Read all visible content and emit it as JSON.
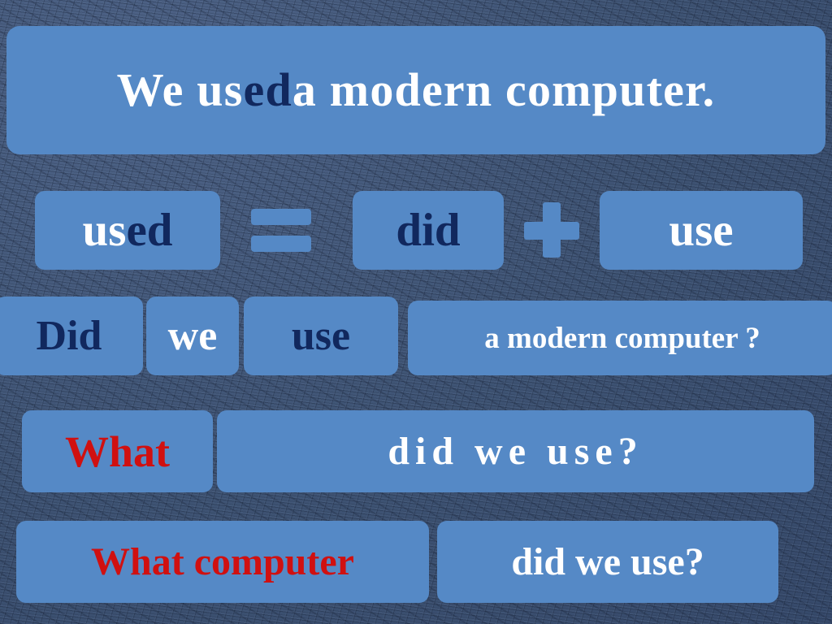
{
  "slide": {
    "background_color": "#44597a",
    "card_color": "#5589c6",
    "accent_white": "#ffffff",
    "accent_navy": "#11285e",
    "accent_red": "#d01010"
  },
  "title": {
    "part_white_1": "We us",
    "part_navy": "ed",
    "part_white_2": " a modern computer."
  },
  "equation": {
    "used_white": "us",
    "used_navy": "ed",
    "equals_symbol": "=",
    "did": "did",
    "plus_symbol": "+",
    "use": "use"
  },
  "question_row": {
    "did": "Did",
    "we": "we",
    "use": "use",
    "rest": "a modern computer ?"
  },
  "wh_row": {
    "what": "What",
    "predicate": "did we use?"
  },
  "wh_long_row": {
    "what_computer": "What computer",
    "predicate": "did we use?"
  }
}
